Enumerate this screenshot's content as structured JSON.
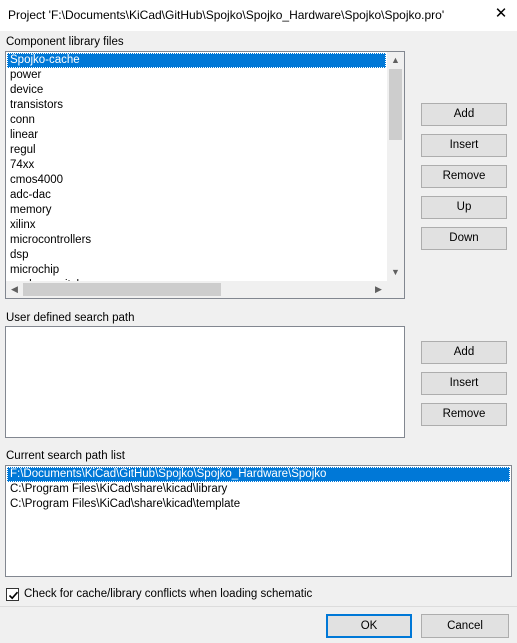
{
  "window": {
    "title": "Project 'F:\\Documents\\KiCad\\GitHub\\Spojko\\Spojko_Hardware\\Spojko\\Spojko.pro'",
    "close_icon": "close-icon"
  },
  "component_libraries": {
    "label": "Component library files",
    "items": [
      "Spojko-cache",
      "power",
      "device",
      "transistors",
      "conn",
      "linear",
      "regul",
      "74xx",
      "cmos4000",
      "adc-dac",
      "memory",
      "xilinx",
      "microcontrollers",
      "dsp",
      "microchip",
      "analog_switches"
    ],
    "selected_index": 0,
    "buttons": {
      "add": "Add",
      "insert": "Insert",
      "remove": "Remove",
      "up": "Up",
      "down": "Down"
    }
  },
  "user_search_path": {
    "label": "User defined search path",
    "items": [],
    "buttons": {
      "add": "Add",
      "insert": "Insert",
      "remove": "Remove"
    }
  },
  "current_search_path": {
    "label": "Current search path list",
    "items": [
      "F:\\Documents\\KiCad\\GitHub\\Spojko\\Spojko_Hardware\\Spojko",
      "C:\\Program Files\\KiCad\\share\\kicad\\library",
      "C:\\Program Files\\KiCad\\share\\kicad\\template"
    ],
    "selected_index": 0
  },
  "options": {
    "check_conflicts_label": "Check for cache/library conflicts when loading schematic",
    "check_conflicts_checked": true
  },
  "footer": {
    "ok": "OK",
    "cancel": "Cancel"
  },
  "colors": {
    "selection": "#0078d7",
    "dialog_bg": "#f0f0f0"
  }
}
